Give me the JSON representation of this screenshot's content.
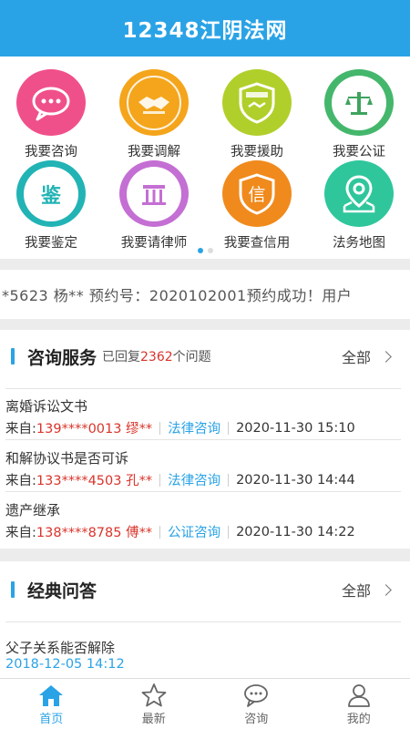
{
  "header": {
    "title": "12348江阴法网"
  },
  "services": [
    {
      "label": "我要咨询",
      "icon": "chat-bubble-icon",
      "color": "#f0508a"
    },
    {
      "label": "我要调解",
      "icon": "handshake-icon",
      "color": "#f4a51b"
    },
    {
      "label": "我要援助",
      "icon": "legal-aid-shield-icon",
      "color": "#b0cf2a"
    },
    {
      "label": "我要公证",
      "icon": "notary-emblem-icon",
      "color": "#44b76c"
    },
    {
      "label": "我要鉴定",
      "icon": "appraisal-seal-icon",
      "color": "#22b3b5"
    },
    {
      "label": "我要请律师",
      "icon": "lawyer-emblem-icon",
      "color": "#c46fd3"
    },
    {
      "label": "我要查信用",
      "icon": "credit-shield-icon",
      "color": "#f08a1c"
    },
    {
      "label": "法务地图",
      "icon": "map-pin-icon",
      "color": "#2fc69c"
    }
  ],
  "service_glyphs": {
    "appraisal": "鉴",
    "credit": "信"
  },
  "carousel": {
    "page_count": 2,
    "active_index": 0
  },
  "ticker": {
    "text": "*5623  杨**  预约号：2020102001预约成功！用户"
  },
  "consult": {
    "title": "咨询服务",
    "replied_prefix": "已回复",
    "replied_count": "2362",
    "replied_suffix": "个问题",
    "all_label": "全部",
    "items": [
      {
        "title": "离婚诉讼文书",
        "from_label": "来自:",
        "user": "139****0013 缪**",
        "category": "法律咨询",
        "time": "2020-11-30 15:10"
      },
      {
        "title": "和解协议书是否可诉",
        "from_label": "来自:",
        "user": "133****4503 孔**",
        "category": "法律咨询",
        "time": "2020-11-30 14:44"
      },
      {
        "title": "遗产继承",
        "from_label": "来自:",
        "user": "138****8785 傅**",
        "category": "公证咨询",
        "time": "2020-11-30 14:22"
      }
    ]
  },
  "faq": {
    "title": "经典问答",
    "all_label": "全部",
    "items": [
      {
        "title": "父子关系能否解除",
        "date": "2018-12-05 14:12"
      }
    ]
  },
  "tabbar": {
    "items": [
      {
        "label": "首页",
        "icon": "home-icon",
        "active": true
      },
      {
        "label": "最新",
        "icon": "star-icon",
        "active": false
      },
      {
        "label": "咨询",
        "icon": "chat-icon",
        "active": false
      },
      {
        "label": "我的",
        "icon": "user-icon",
        "active": false
      }
    ]
  }
}
